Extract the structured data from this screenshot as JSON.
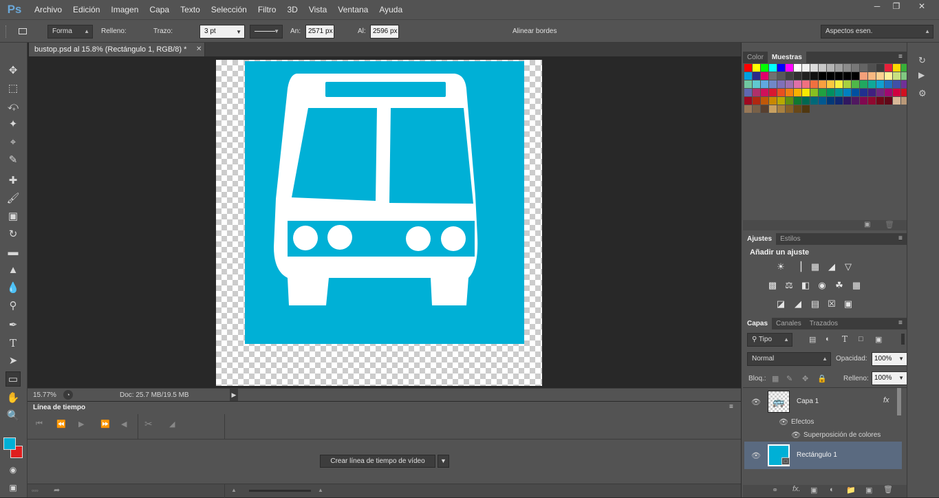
{
  "app": {
    "logo": "Ps"
  },
  "menu": [
    "Archivo",
    "Edición",
    "Imagen",
    "Capa",
    "Texto",
    "Selección",
    "Filtro",
    "3D",
    "Vista",
    "Ventana",
    "Ayuda"
  ],
  "options": {
    "mode": "Forma",
    "fill_label": "Relleno:",
    "fill_color": "#00b0d6",
    "stroke_label": "Trazo:",
    "stroke_width": "3 pt",
    "width_label": "An:",
    "width_value": "2571 px",
    "height_label": "Al:",
    "height_value": "2596 px",
    "align_edges_label": "Alinear bordes",
    "align_edges_checked": true,
    "workspace": "Aspectos esen."
  },
  "document": {
    "tab_title": "bustop.psd al 15.8% (Rectángulo 1, RGB/8) *",
    "zoom": "15.77%",
    "doc_size": "Doc: 25.7 MB/19.5 MB",
    "sign_color": "#00b0d6"
  },
  "timeline": {
    "title": "Línea de tiempo",
    "create_button": "Crear línea de tiempo de vídeo"
  },
  "panels": {
    "swatches": {
      "tabs": [
        "Color",
        "Muestras"
      ],
      "active": "Muestras",
      "rows": [
        [
          "#ff0000",
          "#ffff00",
          "#00ff00",
          "#00ffff",
          "#0000ff",
          "#ff00ff",
          "#ffffff",
          "#f0f0f0",
          "#dcdcdc",
          "#c8c8c8",
          "#b4b4b4",
          "#a0a0a0",
          "#8c8c8c",
          "#787878",
          "#646464",
          "#505050",
          "#3c3c3c",
          "#e8203a",
          "#fcd800",
          "#38b038"
        ],
        [
          "#00a0e0",
          "#2a2a8a",
          "#e0006a",
          "#707070",
          "#585858",
          "#404040",
          "#303030",
          "#202020",
          "#101010",
          "#000000",
          "#000000",
          "#000000",
          "#000000",
          "#000000",
          "#f4a07a",
          "#f8b880",
          "#fcd090",
          "#fff09a",
          "#c8e080",
          "#80c880"
        ],
        [
          "#70c8a0",
          "#60c8d0",
          "#60a8e0",
          "#7088c8",
          "#8070b8",
          "#a070b0",
          "#e070a8",
          "#f07080",
          "#f07040",
          "#f8a040",
          "#fcc840",
          "#f8f040",
          "#a8d040",
          "#50b848",
          "#20a860",
          "#10a898",
          "#10a0d0",
          "#2070c0",
          "#4050a8",
          "#703098"
        ],
        [
          "#6068b0",
          "#b0306a",
          "#d0105a",
          "#d81830",
          "#e85020",
          "#f08010",
          "#f8b000",
          "#f8e800",
          "#88c020",
          "#20a040",
          "#009060",
          "#009090",
          "#0080c0",
          "#0050a0",
          "#203090",
          "#402080",
          "#702880",
          "#a00870",
          "#d00040",
          "#d01020"
        ],
        [
          "#a00820",
          "#b02810",
          "#c05808",
          "#c88800",
          "#b8a800",
          "#609010",
          "#107830",
          "#006850",
          "#006878",
          "#005890",
          "#003878",
          "#102870",
          "#301860",
          "#501860",
          "#800850",
          "#900830",
          "#700818",
          "#600818",
          "#d8b898",
          "#b89878"
        ],
        [
          "#987858",
          "#786048",
          "#584030",
          "#c8a060",
          "#a88040",
          "#886028",
          "#684818",
          "#503810"
        ]
      ]
    },
    "adjustments": {
      "tabs": [
        "Ajustes",
        "Estilos"
      ],
      "active": "Ajustes",
      "title": "Añadir un ajuste",
      "icons": [
        [
          "brightness-icon",
          "levels-icon",
          "curves-icon",
          "exposure-icon",
          "vibrance-icon"
        ],
        [
          "hue-saturation-icon",
          "color-balance-icon",
          "black-white-icon",
          "photo-filter-icon",
          "channel-mixer-icon",
          "color-lookup-icon"
        ],
        [
          "invert-icon",
          "posterize-icon",
          "threshold-icon",
          "selective-color-icon",
          "gradient-map-icon"
        ]
      ]
    },
    "layers": {
      "tabs": [
        "Capas",
        "Canales",
        "Trazados"
      ],
      "active": "Capas",
      "filter": "Tipo",
      "blend_mode": "Normal",
      "opacity_label": "Opacidad:",
      "opacity": "100%",
      "lock_label": "Bloq.:",
      "fill_label": "Relleno:",
      "fill": "100%",
      "items": [
        {
          "name": "Capa 1",
          "has_fx": true,
          "fx": "fx"
        },
        {
          "effects_label": "Efectos"
        },
        {
          "effect": "Superposición de colores"
        },
        {
          "name": "Rectángulo 1",
          "selected": true
        }
      ]
    }
  }
}
